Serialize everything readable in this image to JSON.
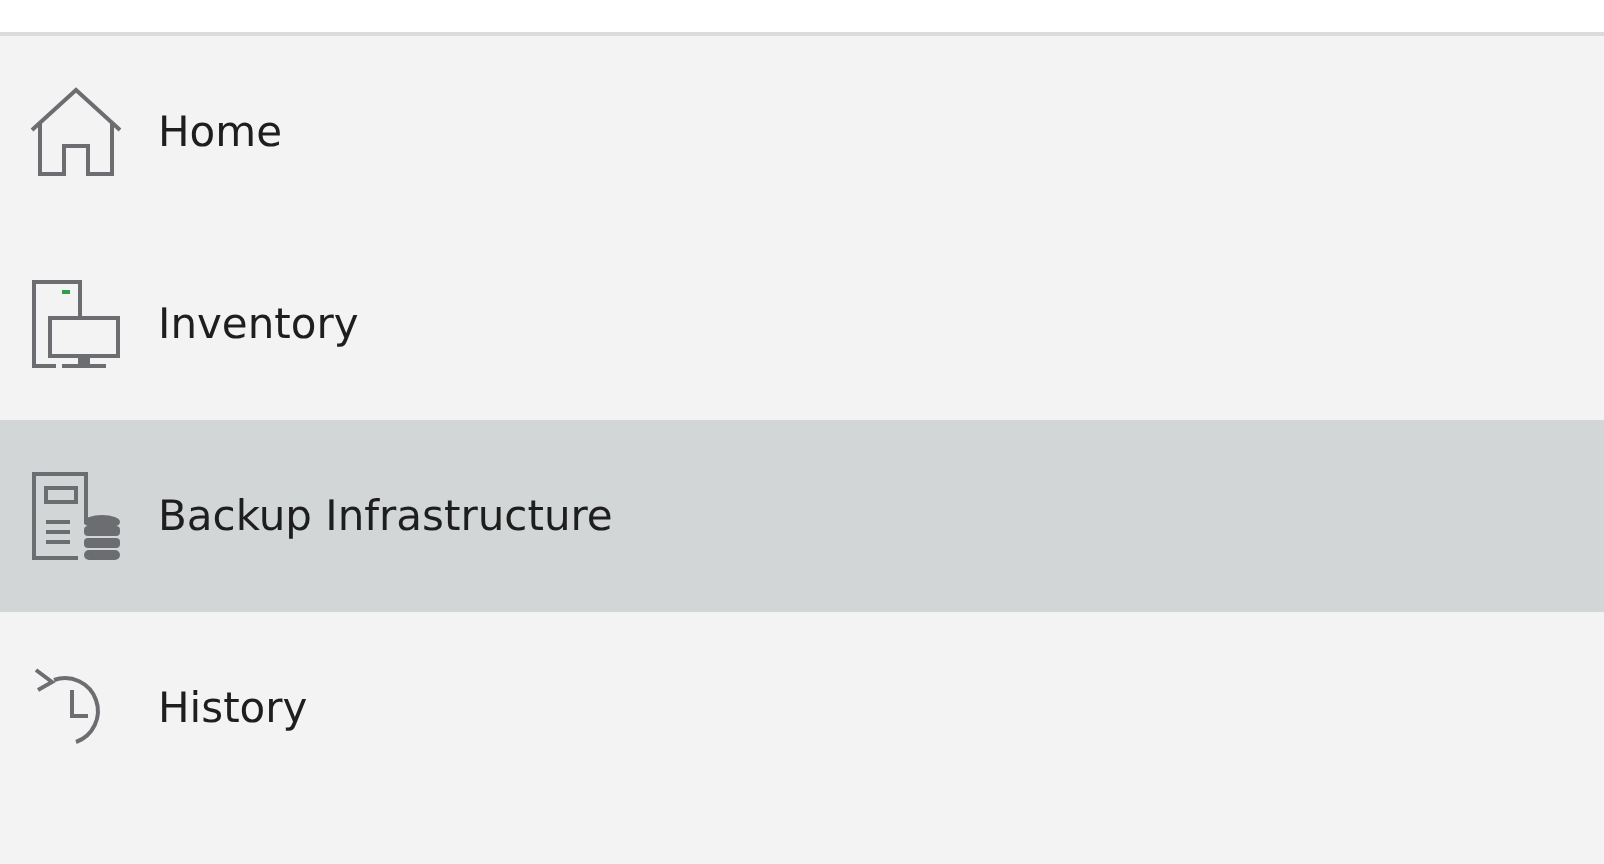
{
  "navigation": {
    "items": [
      {
        "label": "Home",
        "kind": "home",
        "selected": false
      },
      {
        "label": "Inventory",
        "kind": "inventory",
        "selected": false
      },
      {
        "label": "Backup Infrastructure",
        "kind": "backup",
        "selected": true
      },
      {
        "label": "History",
        "kind": "history",
        "selected": false
      }
    ]
  }
}
